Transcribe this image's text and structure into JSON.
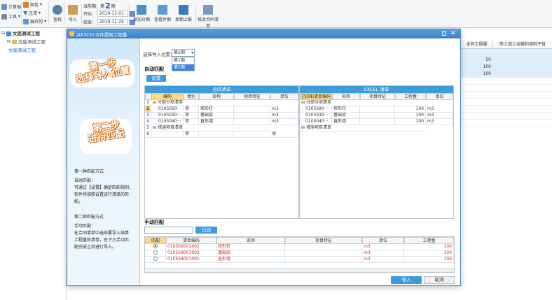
{
  "ribbon": {
    "left_items": [
      "计算器",
      "工具"
    ],
    "format_items": [
      "颜色",
      "过滤",
      "展开到"
    ],
    "buttons": {
      "find": "查找",
      "import": "导入"
    },
    "period": {
      "label": "当前期：第",
      "value": "2",
      "unit": "期",
      "start_label": "开始：",
      "start": "2019-11-01",
      "end_label": "结束：",
      "end": "2019-11-25"
    },
    "right_buttons": [
      "添加分期",
      "查看步期",
      "单期上报",
      "修改合同清单"
    ]
  },
  "tree": {
    "root": "文底测试工程",
    "child": "文底测试工程",
    "leaf": "文底测试工程"
  },
  "bg_table": {
    "headers": [
      "本同工程量",
      "房土道土运输和调料子目"
    ],
    "values": [
      "50",
      "100",
      "100"
    ]
  },
  "dialog": {
    "title": "从EXCEL文件提取工程量",
    "import_position_label": "选择导入位置：",
    "select_value": "第2期",
    "dropdown_options": [
      "第1期",
      "第2期"
    ],
    "auto_match": {
      "title": "自动匹配",
      "settings_btn": "设置"
    },
    "contract_grid": {
      "title": "合同清单",
      "headers": [
        "编码",
        "类别",
        "名称",
        "项目特征",
        "单位"
      ],
      "rows": [
        {
          "no": "1",
          "code": "分部分项清单",
          "type": "",
          "name": "",
          "feature": "",
          "unit": "",
          "group": true
        },
        {
          "no": "2",
          "code": "0105020···",
          "type": "项",
          "name": "矩形柱",
          "feature": "",
          "unit": "m3",
          "group": false
        },
        {
          "no": "3",
          "code": "0105030···",
          "type": "项",
          "name": "基础梁",
          "feature": "",
          "unit": "m3",
          "group": false
        },
        {
          "no": "4",
          "code": "0105040···",
          "type": "项",
          "name": "直形墙",
          "feature": "",
          "unit": "m3",
          "group": false
        },
        {
          "no": "5",
          "code": "措施项目清单",
          "type": "",
          "name": "",
          "feature": "",
          "unit": "",
          "group": true
        },
        {
          "no": "6",
          "code": "",
          "type": "项",
          "name": "",
          "feature": "",
          "unit": "项",
          "group": false
        }
      ]
    },
    "excel_grid": {
      "title": "EXCEL 清单",
      "headers": [
        "已匹配清单编码",
        "名称",
        "项目特征",
        "工程量",
        "单位"
      ],
      "rows": [
        {
          "code": "分部分项清单",
          "name": "",
          "feature": "",
          "qty": "",
          "unit": "",
          "group": true
        },
        {
          "code": "0105020···",
          "name": "矩形柱",
          "feature": "",
          "qty": "100",
          "unit": "m3",
          "group": false
        },
        {
          "code": "0105030···",
          "name": "基础梁",
          "feature": "",
          "qty": "100",
          "unit": "m3",
          "group": false
        },
        {
          "code": "0105040···",
          "name": "直形墙",
          "feature": "",
          "qty": "100",
          "unit": "m3",
          "group": false
        },
        {
          "code": "措施项目清单",
          "name": "",
          "feature": "",
          "qty": "",
          "unit": "",
          "group": true
        }
      ]
    },
    "manual": {
      "title": "手动匹配",
      "filter_btn": "过滤",
      "headers": [
        "匹配",
        "清单编码",
        "名称",
        "项目特征",
        "单位",
        "工程量"
      ],
      "rows": [
        {
          "code": "010502001002",
          "name": "矩形柱",
          "feature": "",
          "unit": "m3",
          "qty": "100"
        },
        {
          "code": "010503001002",
          "name": "基础梁",
          "feature": "",
          "unit": "m3",
          "qty": "100"
        },
        {
          "code": "010504001001",
          "name": "直形墙",
          "feature": "",
          "unit": "m3",
          "qty": "100"
        }
      ]
    },
    "import_btn": "导入",
    "cancel_btn": "取消",
    "guide": {
      "step1": [
        "第一步",
        "选择导入位置"
      ],
      "step2": [
        "第二步",
        "进行匹配"
      ],
      "method1_title": "第一种匹配方式",
      "method1_lines": [
        "自动匹配：",
        "可通过【设置】确定匹配规则，",
        "软件将按照设置进行清单的匹",
        "配。"
      ],
      "method2_title": "第二种匹配方式",
      "method2_lines": [
        "手动匹配：",
        "在合同清单中选择要导入结算",
        "工程量的清单，在下方手动匹",
        "配完成之后进行导入。"
      ]
    }
  }
}
